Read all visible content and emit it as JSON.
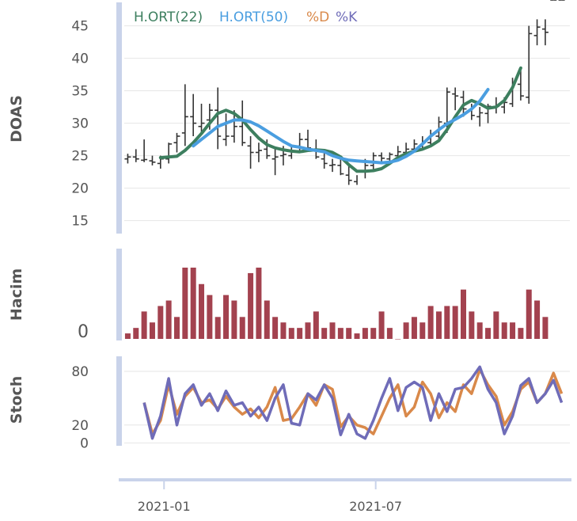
{
  "colors": {
    "ohlc": "#333333",
    "sma22": "#3d7f5f",
    "sma50": "#4a9ee0",
    "stoch_d": "#d9894a",
    "stoch_k": "#6f6cb8",
    "volume": "#a3424f",
    "axis_band": "#c9d3ea",
    "grid": "#e6e6e6"
  },
  "chart_data": [
    {
      "type": "line",
      "panel": "price",
      "ylabel": "DOAS",
      "yticks": [
        15,
        20,
        25,
        30,
        35,
        40,
        45
      ],
      "ylim": [
        13,
        48
      ],
      "legend": [
        "H.ORT(22)",
        "H.ORT(50)",
        "%D",
        "%K"
      ],
      "legend_position": "top-left",
      "ohlc": {
        "x": [
          "2020-12-01",
          "2020-12-08",
          "2020-12-15",
          "2020-12-22",
          "2020-12-29",
          "2021-01-05",
          "2021-01-12",
          "2021-01-19",
          "2021-01-26",
          "2021-02-02",
          "2021-02-09",
          "2021-02-16",
          "2021-02-23",
          "2021-03-02",
          "2021-03-09",
          "2021-03-16",
          "2021-03-23",
          "2021-03-30",
          "2021-04-06",
          "2021-04-13",
          "2021-04-20",
          "2021-04-27",
          "2021-05-04",
          "2021-05-11",
          "2021-05-18",
          "2021-05-25",
          "2021-06-01",
          "2021-06-08",
          "2021-06-15",
          "2021-06-22",
          "2021-06-29",
          "2021-07-06",
          "2021-07-13",
          "2021-07-20",
          "2021-07-27",
          "2021-08-03",
          "2021-08-10",
          "2021-08-17",
          "2021-08-24",
          "2021-08-31",
          "2021-09-07",
          "2021-09-14",
          "2021-09-21",
          "2021-09-28",
          "2021-10-05",
          "2021-10-12",
          "2021-10-19",
          "2021-10-26",
          "2021-11-02",
          "2021-11-09",
          "2021-11-16",
          "2021-11-23",
          "2021-11-30",
          "2021-12-07"
        ],
        "open": [
          24.5,
          24.8,
          24.3,
          24.2,
          23.8,
          24.5,
          27.0,
          28.5,
          31.0,
          29.5,
          30.5,
          32.0,
          27.5,
          28.0,
          29.5,
          26.5,
          25.5,
          26.0,
          24.5,
          25.0,
          25.0,
          26.5,
          27.5,
          26.0,
          24.5,
          23.5,
          23.5,
          22.0,
          21.0,
          22.5,
          23.5,
          25.0,
          24.5,
          25.0,
          25.5,
          26.0,
          26.5,
          27.0,
          28.0,
          30.0,
          34.5,
          34.0,
          32.0,
          31.0,
          31.5,
          32.5,
          32.5,
          33.0,
          36.0,
          34.0,
          43.5,
          44.5
        ],
        "high": [
          25.3,
          26.0,
          27.5,
          25.0,
          25.0,
          27.0,
          28.5,
          36.0,
          34.5,
          33.0,
          33.0,
          35.5,
          31.5,
          32.0,
          33.5,
          28.0,
          27.0,
          27.5,
          26.0,
          26.5,
          26.5,
          28.5,
          29.0,
          27.5,
          25.5,
          24.5,
          24.5,
          23.5,
          22.0,
          24.5,
          25.5,
          25.5,
          25.5,
          26.5,
          27.0,
          27.5,
          28.0,
          29.0,
          31.0,
          35.5,
          35.5,
          35.0,
          33.0,
          32.5,
          33.0,
          34.0,
          34.0,
          37.0,
          38.5,
          45.0,
          46.0,
          46.0
        ],
        "low": [
          23.8,
          24.0,
          24.0,
          23.5,
          23.0,
          23.8,
          25.5,
          26.5,
          28.0,
          28.5,
          29.0,
          26.0,
          26.5,
          27.0,
          26.5,
          23.0,
          24.0,
          24.5,
          22.0,
          23.5,
          24.5,
          25.5,
          26.0,
          24.5,
          23.0,
          22.5,
          22.0,
          20.5,
          20.5,
          21.5,
          22.5,
          24.0,
          24.0,
          24.5,
          25.0,
          25.5,
          26.0,
          26.5,
          27.5,
          28.5,
          32.0,
          31.0,
          30.5,
          29.5,
          30.0,
          31.5,
          31.5,
          32.5,
          33.5,
          33.0,
          42.0,
          42.0
        ],
        "close": [
          24.8,
          24.5,
          24.4,
          24.0,
          24.5,
          26.8,
          28.0,
          31.0,
          30.0,
          30.0,
          32.0,
          28.0,
          28.0,
          29.5,
          27.0,
          25.5,
          25.8,
          25.0,
          24.8,
          25.2,
          26.5,
          27.5,
          26.2,
          24.8,
          23.8,
          23.6,
          22.2,
          21.2,
          22.6,
          23.5,
          25.0,
          24.6,
          25.2,
          25.6,
          26.0,
          26.8,
          27.2,
          28.2,
          30.2,
          34.8,
          34.2,
          32.2,
          31.2,
          31.6,
          32.6,
          32.6,
          33.2,
          36.2,
          34.2,
          43.8,
          44.8,
          44.0
        ]
      },
      "series": [
        {
          "name": "H.ORT(22)",
          "x_start": "2020-12-29",
          "values": [
            24.7,
            24.8,
            24.9,
            25.8,
            27.0,
            28.4,
            30.0,
            31.5,
            32.0,
            31.5,
            30.5,
            29.0,
            27.7,
            26.7,
            26.2,
            25.9,
            25.7,
            25.6,
            25.8,
            25.9,
            25.8,
            25.5,
            24.8,
            23.6,
            22.6,
            22.6,
            22.7,
            23.0,
            23.8,
            24.7,
            25.3,
            25.7,
            26.0,
            26.5,
            27.3,
            29.0,
            31.0,
            32.8,
            33.5,
            33.0,
            32.3,
            32.5,
            33.5,
            35.5,
            38.5
          ]
        },
        {
          "name": "H.ORT(50)",
          "x_start": "2021-01-26",
          "values": [
            26.5,
            27.5,
            28.5,
            29.5,
            30.0,
            30.5,
            30.5,
            30.2,
            29.6,
            28.8,
            28.0,
            27.2,
            26.5,
            26.3,
            26.0,
            25.8,
            25.6,
            25.0,
            24.6,
            24.3,
            24.2,
            24.1,
            24.0,
            23.9,
            24.0,
            24.3,
            24.9,
            25.7,
            26.8,
            28.0,
            29.0,
            29.9,
            30.6,
            31.3,
            32.2,
            33.4,
            35.2
          ]
        }
      ]
    },
    {
      "type": "bar",
      "panel": "volume",
      "ylabel": "Hacim",
      "yticks": [
        "0"
      ],
      "values": [
        1,
        2,
        5,
        3,
        6,
        7,
        4,
        13,
        13,
        10,
        8,
        4,
        8,
        7,
        4,
        12,
        13,
        7,
        4,
        3,
        2,
        2,
        3,
        5,
        2,
        3,
        2,
        2,
        1,
        2,
        2,
        5,
        2,
        0,
        3,
        4,
        3,
        6,
        5,
        6,
        6,
        9,
        5,
        3,
        2,
        5,
        3,
        3,
        2,
        9,
        7,
        4
      ]
    },
    {
      "type": "line",
      "panel": "stochastic",
      "ylabel": "Stoch",
      "yticks": [
        0,
        20,
        80
      ],
      "ylim": [
        -5,
        95
      ],
      "series": [
        {
          "name": "%D",
          "values": [
            45,
            10,
            25,
            65,
            32,
            52,
            62,
            45,
            48,
            38,
            52,
            40,
            32,
            38,
            28,
            40,
            62,
            25,
            27,
            40,
            55,
            42,
            65,
            60,
            18,
            30,
            20,
            17,
            10,
            30,
            50,
            65,
            30,
            40,
            68,
            55,
            28,
            45,
            35,
            65,
            55,
            82,
            65,
            52,
            20,
            35,
            60,
            68,
            45,
            55,
            78,
            55
          ]
        },
        {
          "name": "%K",
          "values": [
            45,
            5,
            30,
            72,
            20,
            55,
            65,
            42,
            55,
            36,
            58,
            42,
            45,
            30,
            40,
            25,
            50,
            65,
            22,
            20,
            55,
            48,
            65,
            50,
            9,
            32,
            10,
            5,
            25,
            50,
            72,
            36,
            62,
            68,
            62,
            25,
            55,
            35,
            60,
            62,
            72,
            85,
            60,
            45,
            10,
            30,
            64,
            72,
            45,
            55,
            70,
            45
          ]
        }
      ]
    },
    {
      "type": "line",
      "panel": "x-axis",
      "x_ticks": [
        "2021-01",
        "2021-07"
      ]
    }
  ]
}
